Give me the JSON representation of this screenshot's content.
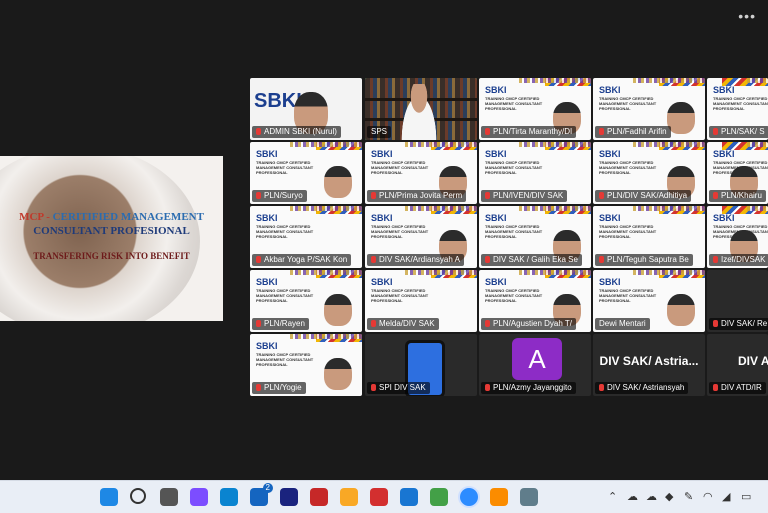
{
  "window": {
    "more_glyph": "•••"
  },
  "shared_screen": {
    "line1_prefix": "MCP - ",
    "line1_rest": "CERITIFIED MANAGEMENT",
    "line2": "CONSULTANT PROFESIONAL",
    "line3": "TRANSFERING RISK INTO BENEFIT"
  },
  "slide": {
    "logo": "SBKI",
    "text": "TRAINING CMCP CERTIFIED MANAGEMENT CONSULTANT PROFESSIONAL"
  },
  "participants": [
    {
      "name": "ADMIN SBKI (Nurul)",
      "muted": true,
      "kind": "video"
    },
    {
      "name": "SPS",
      "muted": false,
      "kind": "books",
      "active": true
    },
    {
      "name": "PLN/Tirta Maranthy/DI",
      "muted": true,
      "kind": "slide"
    },
    {
      "name": "PLN/Fadhil Arifin",
      "muted": true,
      "kind": "slide"
    },
    {
      "name": "PLN/SAK/ S",
      "muted": true,
      "kind": "slide"
    },
    {
      "name": "PLN/Suryo",
      "muted": true,
      "kind": "slide"
    },
    {
      "name": "PLN/Prima Jovita Perm",
      "muted": true,
      "kind": "slide"
    },
    {
      "name": "PLN/IVEN/DIV SAK",
      "muted": true,
      "kind": "slide"
    },
    {
      "name": "PLN/DIV SAK/Adhitiya",
      "muted": true,
      "kind": "slide"
    },
    {
      "name": "PLN/Khairu",
      "muted": true,
      "kind": "slide"
    },
    {
      "name": "Akbar Yoga P/SAK Kon",
      "muted": true,
      "kind": "slide"
    },
    {
      "name": "DIV SAK/Ardiansyah A",
      "muted": true,
      "kind": "slide"
    },
    {
      "name": "DIV SAK / Galih Eka Se",
      "muted": true,
      "kind": "slide"
    },
    {
      "name": "PLN/Teguh Saputra Be",
      "muted": true,
      "kind": "slide"
    },
    {
      "name": "Izef/DIVSAK",
      "muted": true,
      "kind": "slide"
    },
    {
      "name": "PLN/Rayen",
      "muted": true,
      "kind": "slide"
    },
    {
      "name": "Melda/DIV SAK",
      "muted": true,
      "kind": "slide"
    },
    {
      "name": "PLN/Agustien Dyah T/",
      "muted": true,
      "kind": "slide"
    },
    {
      "name": "Dewi Mentari",
      "muted": false,
      "kind": "slide"
    },
    {
      "name": "DIV SAK/ Re",
      "muted": true,
      "kind": "dark"
    },
    {
      "name": "PLN/Yogie",
      "muted": true,
      "kind": "slide"
    },
    {
      "name": "SPI DIV SAK",
      "muted": true,
      "kind": "phone"
    },
    {
      "name": "PLN/Azmy Jayanggito",
      "muted": true,
      "kind": "avatar",
      "avatar_letter": "A",
      "avatar_color": "#8d2cc6"
    },
    {
      "name": "DIV SAK/ Astriansyah",
      "muted": true,
      "kind": "nameonly",
      "big": "DIV SAK/ Astria..."
    },
    {
      "name": "DIV ATD/IR",
      "muted": true,
      "kind": "nameonly",
      "big": "DIV ATD/"
    }
  ],
  "taskbar": {
    "icons": [
      "windows-start-icon",
      "search-icon",
      "task-view-icon",
      "copilot-icon",
      "edge-icon",
      "store-icon",
      "l-app-icon",
      "mcafee-icon",
      "file-explorer-icon",
      "wps-icon",
      "todo-icon",
      "chrome-icon",
      "zoom-icon",
      "chrome-profile-icon",
      "settings-icon"
    ],
    "store_badge": "2",
    "tray": [
      "chevron-up-icon",
      "cloud-icon",
      "cloud-sync-icon",
      "shield-icon",
      "pen-icon",
      "wifi-icon",
      "speaker-icon",
      "battery-icon"
    ]
  }
}
